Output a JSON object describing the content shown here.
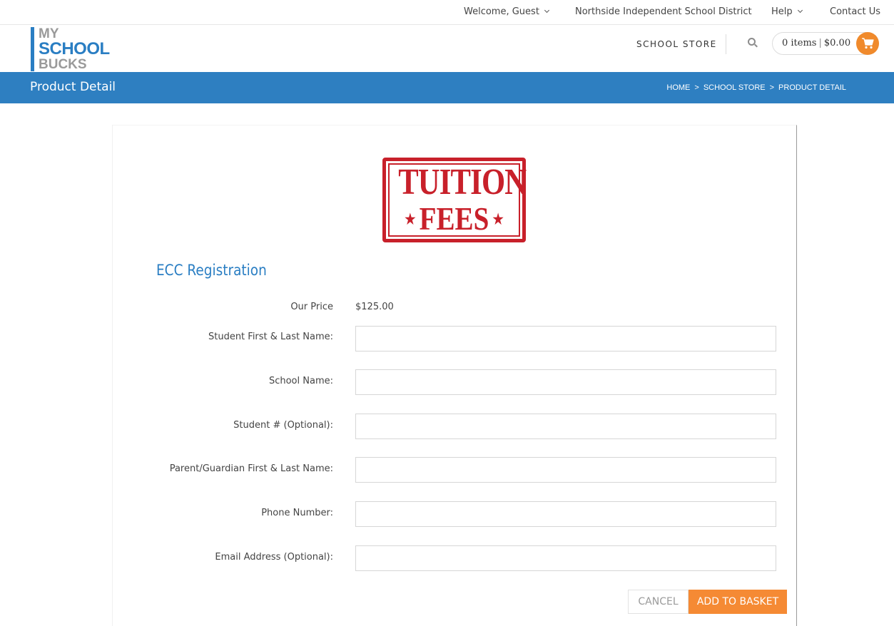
{
  "topbar": {
    "welcome": "Welcome, Guest",
    "district": "Northside Independent School District",
    "help": "Help",
    "contact": "Contact Us"
  },
  "header": {
    "logo": {
      "line1": "MY",
      "line2": "SCHOOL",
      "line3": "BUCKS"
    },
    "store_link": "SCHOOL STORE",
    "cart": {
      "items": "0 items",
      "total": "$0.00"
    }
  },
  "page": {
    "title": "Product Detail",
    "breadcrumbs": [
      "HOME",
      "SCHOOL STORE",
      "PRODUCT DETAIL"
    ]
  },
  "product": {
    "image_text": {
      "line1": "TUITION",
      "line2": "FEES"
    },
    "name": "ECC Registration",
    "price_label": "Our Price",
    "price": "$125.00"
  },
  "form": {
    "fields": [
      {
        "label": "Student First & Last Name:",
        "value": ""
      },
      {
        "label": "School Name:",
        "value": ""
      },
      {
        "label": "Student # (Optional):",
        "value": ""
      },
      {
        "label": "Parent/Guardian First & Last Name:",
        "value": ""
      },
      {
        "label": "Phone Number:",
        "value": ""
      },
      {
        "label": "Email Address (Optional):",
        "value": ""
      }
    ],
    "cancel_label": "CANCEL",
    "add_label": "ADD TO BASKET"
  },
  "colors": {
    "brand_blue": "#2e7fc1",
    "accent_orange": "#f58a34",
    "stamp_red": "#c8202a"
  }
}
